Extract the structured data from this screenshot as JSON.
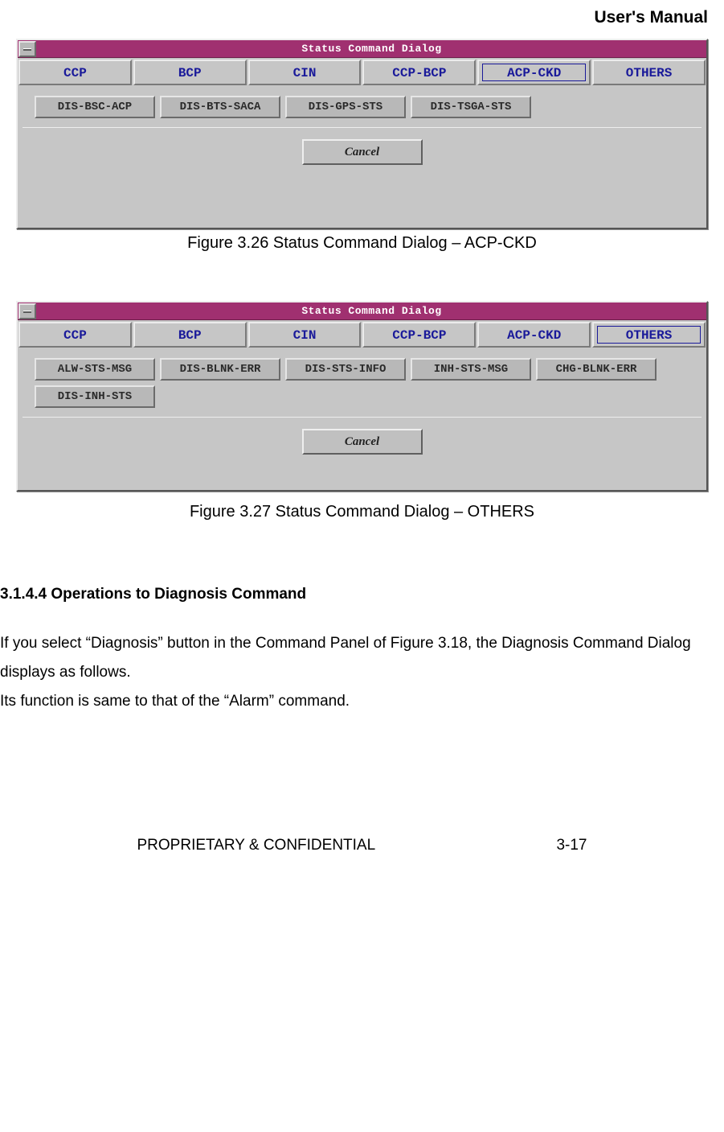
{
  "header": {
    "corner_title": "User's Manual"
  },
  "dialog1": {
    "title": "Status Command Dialog",
    "tabs": [
      "CCP",
      "BCP",
      "CIN",
      "CCP-BCP",
      "ACP-CKD",
      "OTHERS"
    ],
    "selected_index": 4,
    "buttons": [
      "DIS-BSC-ACP",
      "DIS-BTS-SACA",
      "DIS-GPS-STS",
      "DIS-TSGA-STS"
    ],
    "cancel_label": "Cancel"
  },
  "caption1": "Figure 3.26 Status Command Dialog – ACP-CKD",
  "dialog2": {
    "title": "Status Command Dialog",
    "tabs": [
      "CCP",
      "BCP",
      "CIN",
      "CCP-BCP",
      "ACP-CKD",
      "OTHERS"
    ],
    "selected_index": 5,
    "buttons_row1": [
      "ALW-STS-MSG",
      "DIS-BLNK-ERR",
      "DIS-STS-INFO",
      "INH-STS-MSG"
    ],
    "buttons_row2": [
      "CHG-BLNK-ERR",
      "DIS-INH-STS"
    ],
    "cancel_label": "Cancel"
  },
  "caption2": "Figure 3.27 Status Command Dialog – OTHERS",
  "section": {
    "heading": "3.1.4.4 Operations to Diagnosis Command",
    "p1": "If you select “Diagnosis” button in the Command Panel of Figure 3.18, the Diagnosis Command Dialog displays as follows.",
    "p2": "Its function is same to that of the “Alarm” command."
  },
  "footer": {
    "left": "PROPRIETARY & CONFIDENTIAL",
    "right": "3-17"
  }
}
